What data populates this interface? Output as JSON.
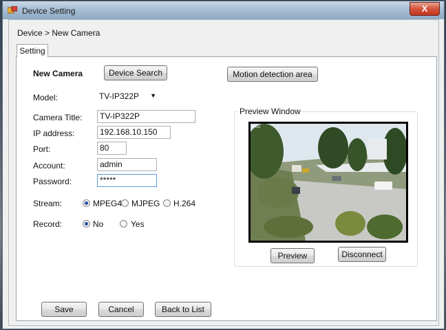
{
  "window": {
    "title": "Device Setting",
    "close": "X"
  },
  "breadcrumb": "Device > New Camera",
  "tab": {
    "label": "Setting"
  },
  "form": {
    "heading": "New Camera",
    "device_search": "Device Search",
    "motion_detection": "Motion detection area",
    "model": {
      "label": "Model:",
      "value": "TV-IP322P"
    },
    "camera_title": {
      "label": "Camera Title:",
      "value": "TV-IP322P"
    },
    "ip_address": {
      "label": "IP address:",
      "value": "192.168.10.150"
    },
    "port": {
      "label": "Port:",
      "value": "80"
    },
    "account": {
      "label": "Account:",
      "value": "admin"
    },
    "password": {
      "label": "Password:",
      "value": "*****"
    },
    "stream": {
      "label": "Stream:",
      "options": [
        "MPEG4",
        "MJPEG",
        "H.264"
      ],
      "selected": "MPEG4"
    },
    "record": {
      "label": "Record:",
      "options": [
        "No",
        "Yes"
      ],
      "selected": "No"
    }
  },
  "preview": {
    "title": "Preview Window",
    "preview_btn": "Preview",
    "disconnect_btn": "Disconnect"
  },
  "footer": {
    "save": "Save",
    "cancel": "Cancel",
    "back": "Back to List"
  },
  "colors": {
    "accent": "#1f4fa0",
    "close": "#c2351e"
  }
}
